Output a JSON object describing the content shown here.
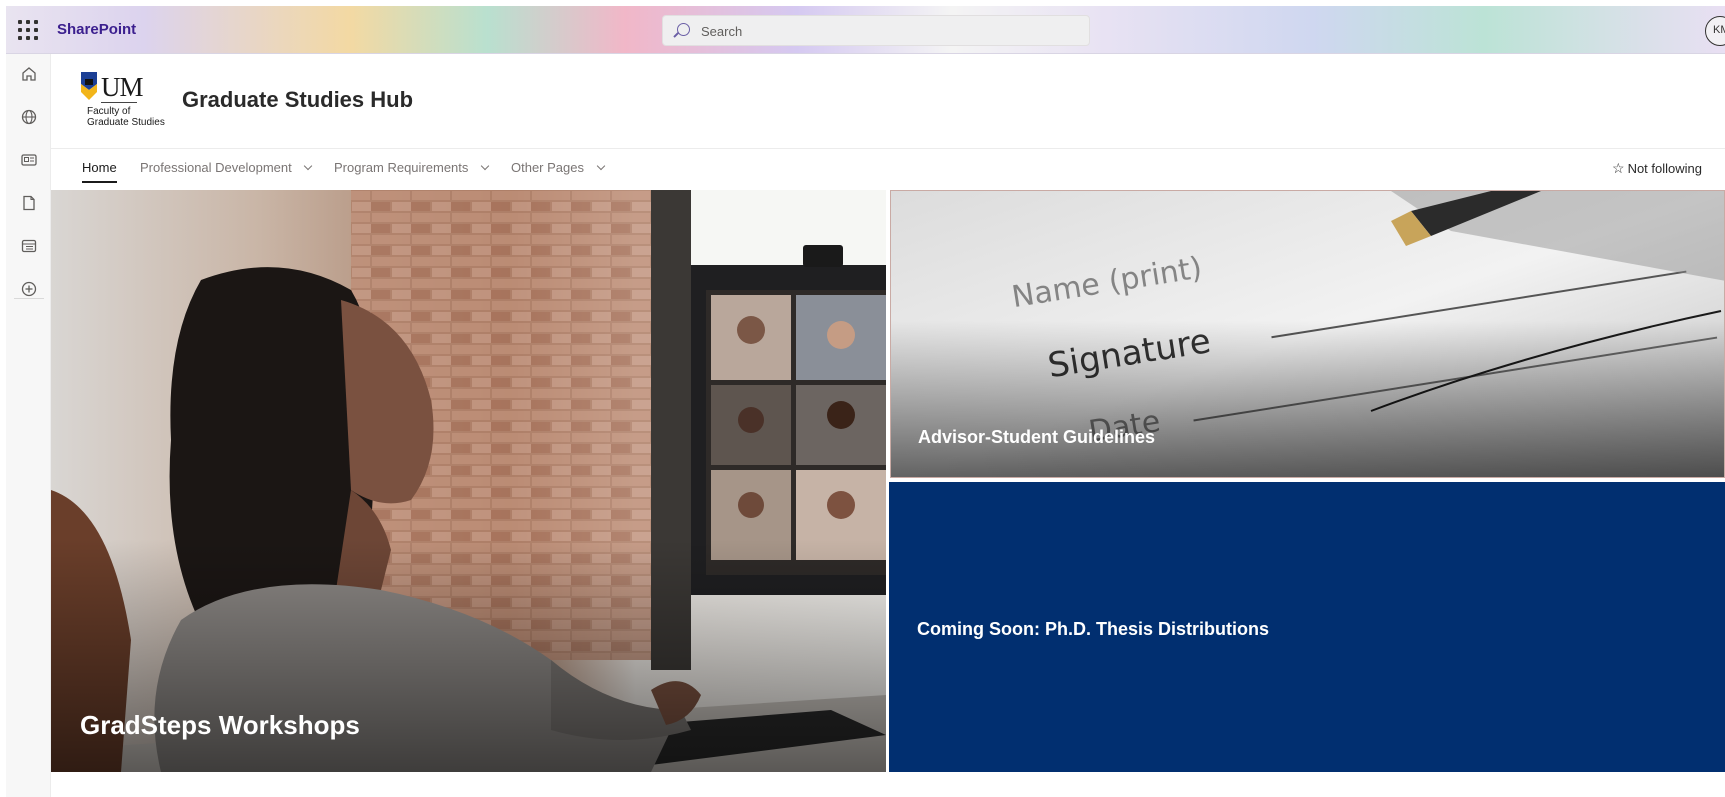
{
  "suite_bar": {
    "app_name": "SharePoint",
    "search_placeholder": "Search",
    "avatar_initials": "KM"
  },
  "left_rail": {
    "icons": [
      "home-icon",
      "globe-icon",
      "news-icon",
      "file-icon",
      "list-icon",
      "add-icon"
    ]
  },
  "site": {
    "logo": {
      "mark": "UM",
      "subtitle_line1": "Faculty of",
      "subtitle_line2": "Graduate Studies"
    },
    "title": "Graduate Studies Hub"
  },
  "nav": {
    "items": [
      {
        "label": "Home",
        "active": true,
        "has_dropdown": false
      },
      {
        "label": "Professional Development",
        "active": false,
        "has_dropdown": true
      },
      {
        "label": "Program Requirements",
        "active": false,
        "has_dropdown": true
      },
      {
        "label": "Other Pages",
        "active": false,
        "has_dropdown": true
      }
    ],
    "follow_label": "Not following"
  },
  "hero": {
    "tiles": [
      {
        "title": "GradSteps Workshops",
        "image": "woman-video-call-photo"
      },
      {
        "title": "Advisor-Student Guidelines",
        "image": "signature-form-photo"
      },
      {
        "title": "Coming Soon: Ph.D. Thesis Distributions",
        "background": "#012f70"
      }
    ]
  },
  "colors": {
    "brand_purple": "#3b1f8e",
    "tile_navy": "#012f70"
  }
}
